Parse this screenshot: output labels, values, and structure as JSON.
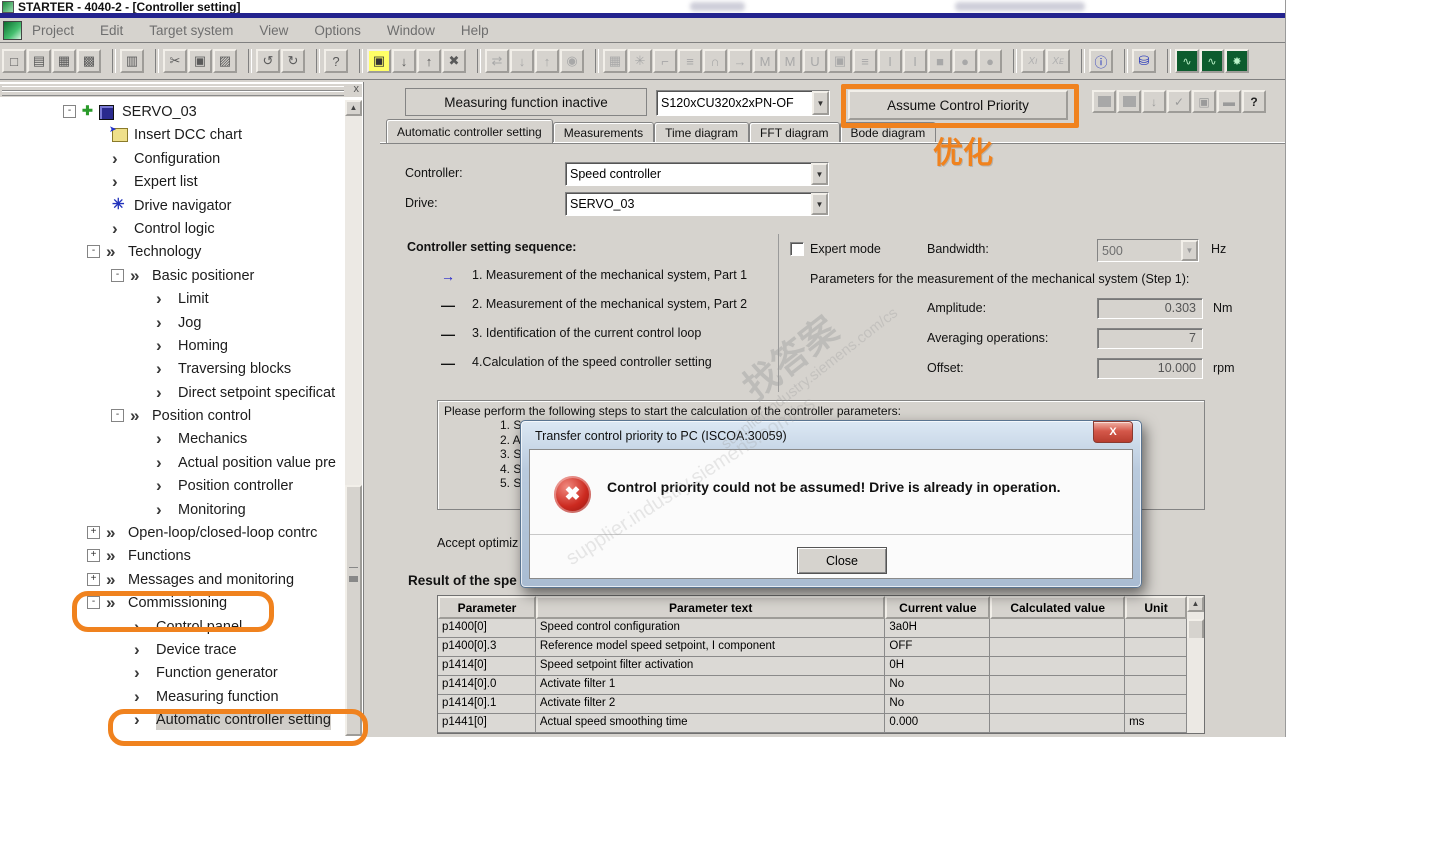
{
  "window": {
    "title": "STARTER - 4040-2 - [Controller setting]",
    "panel_close": "x"
  },
  "menu": [
    "Project",
    "Edit",
    "Target system",
    "View",
    "Options",
    "Window",
    "Help"
  ],
  "toolbar": {
    "groups": [
      {
        "icons": [
          {
            "n": "new-file-icon",
            "g": "□"
          },
          {
            "n": "open-project-icon",
            "g": "▤"
          },
          {
            "n": "save-icon",
            "g": "▦"
          },
          {
            "n": "save-compile-icon",
            "g": "▩"
          }
        ]
      },
      {
        "icons": [
          {
            "n": "print-icon",
            "g": "▥"
          }
        ]
      },
      {
        "icons": [
          {
            "n": "cut-icon",
            "g": "✂"
          },
          {
            "n": "copy-icon",
            "g": "▣"
          },
          {
            "n": "paste-icon",
            "g": "▨"
          }
        ]
      },
      {
        "icons": [
          {
            "n": "undo-icon",
            "g": "↺"
          },
          {
            "n": "redo-icon",
            "g": "↻"
          }
        ]
      },
      {
        "icons": [
          {
            "n": "context-help-icon",
            "g": "?",
            "cls": "dark"
          }
        ]
      },
      {
        "icons": [
          {
            "n": "connect-target-icon",
            "g": "▣",
            "cls": "yel"
          },
          {
            "n": "download-project-icon",
            "g": "↓"
          },
          {
            "n": "upload-project-icon",
            "g": "↑"
          },
          {
            "n": "disconnect-icon",
            "g": "✖"
          }
        ]
      },
      {
        "icons": [
          {
            "n": "compare-icon",
            "g": "⇄",
            "cls": "dis"
          },
          {
            "n": "import-icon",
            "g": "↓",
            "cls": "dis"
          },
          {
            "n": "export-icon",
            "g": "↑",
            "cls": "dis"
          },
          {
            "n": "copy-ram-rom-icon",
            "g": "◉",
            "cls": "dis"
          }
        ]
      },
      {
        "icons": [
          {
            "n": "expert-list-icon",
            "g": "▦",
            "cls": "dis"
          },
          {
            "n": "drive-navigator-icon",
            "g": "✳",
            "cls": "dis"
          },
          {
            "n": "commission-step-icon",
            "g": "⌐",
            "cls": "dis"
          },
          {
            "n": "limits-m-icon",
            "g": "≡",
            "cls": "dis"
          },
          {
            "n": "ramp-icon",
            "g": "∩",
            "cls": "dis"
          },
          {
            "n": "flow-icon",
            "g": "→",
            "cls": "dis"
          },
          {
            "n": "curve-m1-icon",
            "g": "M",
            "cls": "dis"
          },
          {
            "n": "curve-m2-icon",
            "g": "M",
            "cls": "dis"
          },
          {
            "n": "uf-curve-icon",
            "g": "U",
            "cls": "dis"
          },
          {
            "n": "module-icon",
            "g": "▣",
            "cls": "dis"
          },
          {
            "n": "limits-m2-icon",
            "g": "≡",
            "cls": "dis"
          },
          {
            "n": "curve-i1-icon",
            "g": "I",
            "cls": "dis"
          },
          {
            "n": "curve-i2-icon",
            "g": "I",
            "cls": "dis"
          },
          {
            "n": "stop-square-icon",
            "g": "■",
            "cls": "dis"
          },
          {
            "n": "circle1-icon",
            "g": "●",
            "cls": "dis"
          },
          {
            "n": "circle2-icon",
            "g": "●",
            "cls": "dis"
          }
        ]
      },
      {
        "icons": [
          {
            "n": "x-internal-icon",
            "g": "Xı",
            "cls": "small-x"
          },
          {
            "n": "x-external-icon",
            "g": "Xᴇ",
            "cls": "small-x"
          }
        ]
      },
      {
        "icons": [
          {
            "n": "network-info-icon",
            "g": "ⓘ",
            "cls": "blue"
          }
        ]
      },
      {
        "icons": [
          {
            "n": "control-panel-icon",
            "g": "⛁",
            "cls": "blue"
          }
        ]
      },
      {
        "icons": [
          {
            "n": "trace-1-icon",
            "g": "∿",
            "cls": "grn"
          },
          {
            "n": "trace-2-icon",
            "g": "∿",
            "cls": "grn"
          },
          {
            "n": "trace-3-icon",
            "g": "✸",
            "cls": "grn"
          }
        ]
      }
    ]
  },
  "tree": {
    "items": [
      {
        "lvl": 0,
        "type": "group",
        "exp": "-",
        "icon": "drive",
        "label": "SERVO_03"
      },
      {
        "lvl": 1,
        "type": "leaf",
        "icon": "dcc",
        "label": "Insert DCC chart"
      },
      {
        "lvl": 1,
        "type": "leaf",
        "icon": "chev",
        "label": "Configuration"
      },
      {
        "lvl": 1,
        "type": "leaf",
        "icon": "chev",
        "label": "Expert list"
      },
      {
        "lvl": 1,
        "type": "leaf",
        "icon": "gear",
        "label": "Drive navigator"
      },
      {
        "lvl": 1,
        "type": "leaf",
        "icon": "chev",
        "label": "Control logic"
      },
      {
        "lvl": 1,
        "type": "group",
        "exp": "-",
        "icon": "chev2",
        "label": "Technology"
      },
      {
        "lvl": 2,
        "type": "group",
        "exp": "-",
        "icon": "chev2",
        "label": "Basic positioner"
      },
      {
        "lvl": 3,
        "type": "leaf",
        "icon": "chev",
        "label": "Limit"
      },
      {
        "lvl": 3,
        "type": "leaf",
        "icon": "chev",
        "label": "Jog"
      },
      {
        "lvl": 3,
        "type": "leaf",
        "icon": "chev",
        "label": "Homing"
      },
      {
        "lvl": 3,
        "type": "leaf",
        "icon": "chev",
        "label": "Traversing blocks"
      },
      {
        "lvl": 3,
        "type": "leaf",
        "icon": "chev",
        "label": "Direct setpoint specificat"
      },
      {
        "lvl": 2,
        "type": "group",
        "exp": "-",
        "icon": "chev2",
        "label": "Position control"
      },
      {
        "lvl": 3,
        "type": "leaf",
        "icon": "chev",
        "label": "Mechanics"
      },
      {
        "lvl": 3,
        "type": "leaf",
        "icon": "chev",
        "label": "Actual position value pre"
      },
      {
        "lvl": 3,
        "type": "leaf",
        "icon": "chev",
        "label": "Position controller"
      },
      {
        "lvl": 3,
        "type": "leaf",
        "icon": "chev",
        "label": "Monitoring"
      },
      {
        "lvl": 1,
        "type": "group",
        "exp": "+",
        "icon": "chev2",
        "label": "Open-loop/closed-loop contrc"
      },
      {
        "lvl": 1,
        "type": "group",
        "exp": "+",
        "icon": "chev2",
        "label": "Functions"
      },
      {
        "lvl": 1,
        "type": "group",
        "exp": "+",
        "icon": "chev2",
        "label": "Messages and monitoring"
      },
      {
        "lvl": 1,
        "type": "group",
        "exp": "-",
        "icon": "chev2",
        "label": "Commissioning"
      },
      {
        "lvl": 2,
        "type": "leaf",
        "icon": "chev",
        "label": "Control panel"
      },
      {
        "lvl": 2,
        "type": "leaf",
        "icon": "chev",
        "label": "Device trace"
      },
      {
        "lvl": 2,
        "type": "leaf",
        "icon": "chev",
        "label": "Function generator"
      },
      {
        "lvl": 2,
        "type": "leaf",
        "icon": "chev",
        "label": "Measuring function"
      },
      {
        "lvl": 2,
        "type": "leaf",
        "icon": "chev",
        "label": "Automatic controller setting",
        "selected": true
      }
    ]
  },
  "panel": {
    "status_button": "Measuring function inactive",
    "device_combo": "S120xCU320x2xPN-OF",
    "assume_button": "Assume Control Priority",
    "mini_buttons": [
      {
        "n": "window-1-icon",
        "g": "sq"
      },
      {
        "n": "window-2-icon",
        "g": "sq"
      },
      {
        "n": "download-sequence-icon",
        "g": "↓"
      },
      {
        "n": "accept-check-icon",
        "g": "✓"
      },
      {
        "n": "copy-box-icon",
        "g": "▣"
      },
      {
        "n": "apply-block-icon",
        "g": "▬"
      },
      {
        "n": "help-button",
        "g": "?",
        "dark": true
      }
    ],
    "tabs": [
      "Automatic controller setting",
      "Measurements",
      "Time diagram",
      "FFT diagram",
      "Bode diagram"
    ],
    "active_tab_index": 0,
    "controller_label": "Controller:",
    "controller_value": "Speed controller",
    "drive_label": "Drive:",
    "drive_value": "SERVO_03",
    "sequence_title": "Controller setting sequence:",
    "sequence_steps": [
      {
        "marker": "→",
        "text": "1. Measurement of the mechanical system, Part 1",
        "active": true
      },
      {
        "marker": "—",
        "text": "2. Measurement of the mechanical system, Part 2"
      },
      {
        "marker": "—",
        "text": "3. Identification of the current control loop"
      },
      {
        "marker": "—",
        "text": "4.Calculation of the speed controller setting"
      }
    ],
    "expert_mode_label": "Expert mode",
    "bandwidth_label": "Bandwidth:",
    "bandwidth_value": "500",
    "bandwidth_unit": "Hz",
    "params_title": "Parameters for the measurement of the mechanical system (Step 1):",
    "param_fields": [
      {
        "label": "Amplitude:",
        "value": "0.303",
        "unit": "Nm"
      },
      {
        "label": "Averaging operations:",
        "value": "7",
        "unit": ""
      },
      {
        "label": "Offset:",
        "value": "10.000",
        "unit": "rpm"
      }
    ],
    "instructions_intro": "Please perform the following steps to start the calculation of the controller parameters:",
    "instructions_steps": [
      "1. S",
      "2. A",
      "3. S",
      "4. S",
      "5. S"
    ],
    "accept_text": "Accept optimiz",
    "result_heading": "Result of the spe",
    "table": {
      "headers": [
        "Parameter",
        "Parameter text",
        "Current value",
        "Calculated value",
        "Unit"
      ],
      "rows": [
        [
          "p1400[0]",
          "Speed control configuration",
          "3a0H",
          "",
          ""
        ],
        [
          "p1400[0].3",
          "Reference model speed setpoint, I component",
          "OFF",
          "",
          ""
        ],
        [
          "p1414[0]",
          "Speed setpoint filter activation",
          "0H",
          "",
          ""
        ],
        [
          "p1414[0].0",
          "Activate filter 1",
          "No",
          "",
          ""
        ],
        [
          "p1414[0].1",
          "Activate filter 2",
          "No",
          "",
          ""
        ],
        [
          "p1441[0]",
          "Actual speed smoothing time",
          "0.000",
          "",
          "ms"
        ]
      ]
    }
  },
  "dialog": {
    "title": "Transfer control priority to PC (ISCOA:30059)",
    "close_label": "X",
    "message": "Control priority could not be assumed! Drive is already in operation.",
    "button": "Close"
  },
  "annotations": {
    "optimize_text": "优化"
  },
  "watermarks": [
    "找答案",
    "supplier.industry.siemens.com/cs"
  ],
  "colors": {
    "accent_orange": "#f0821e",
    "navy_strip": "#23238e",
    "window_gray": "#d6d3ce",
    "error_red": "#cc2a20",
    "close_red": "#d4584a"
  }
}
